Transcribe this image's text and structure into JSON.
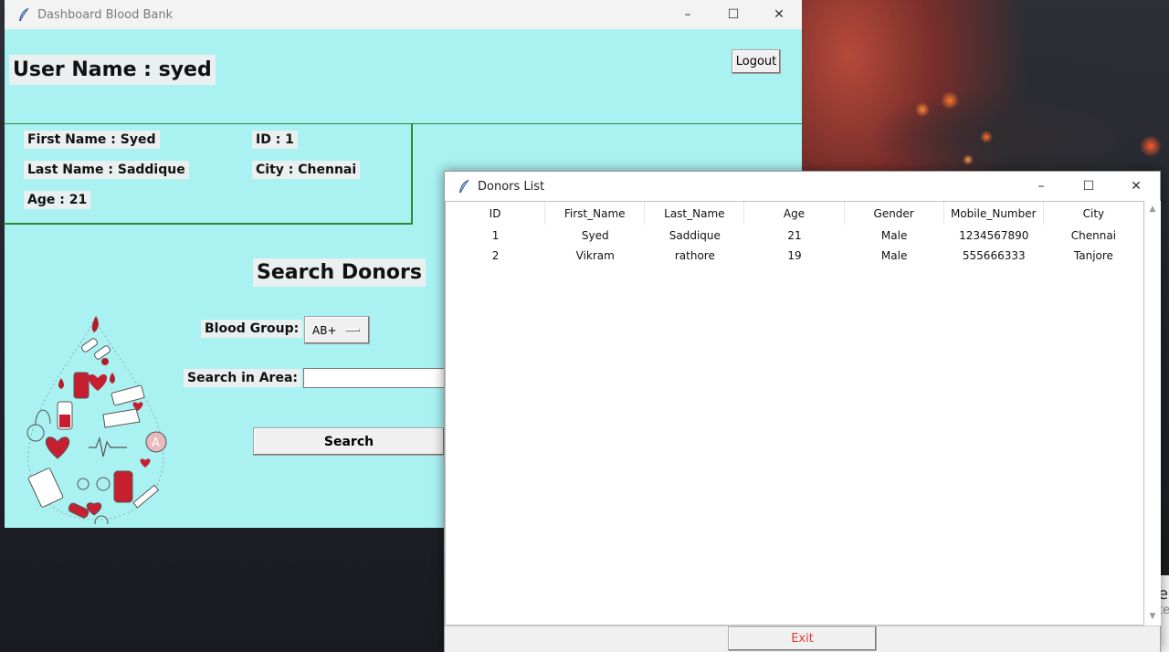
{
  "dashboard": {
    "title": "Dashboard Blood Bank",
    "username_label": "User Name : syed",
    "logout_label": "Logout",
    "first_name": "First Name : Syed",
    "last_name": "Last Name : Saddique",
    "age": "Age : 21",
    "id": "ID : 1",
    "city": "City : Chennai",
    "search_title": "Search Donors",
    "blood_group_label": "Blood Group:",
    "blood_group_value": "AB+",
    "area_label": "Search in Area:",
    "area_value": "",
    "search_button": "Search",
    "background_color": "#aaf1f2"
  },
  "donors_window": {
    "title": "Donors List",
    "columns": [
      "ID",
      "First_Name",
      "Last_Name",
      "Age",
      "Gender",
      "Mobile_Number",
      "City"
    ],
    "rows": [
      [
        "1",
        "Syed",
        "Saddique",
        "21",
        "Male",
        "1234567890",
        "Chennai"
      ],
      [
        "2",
        "Vikram",
        "rathore",
        "19",
        "Male",
        "555666333",
        "Tanjore"
      ]
    ],
    "exit_button": "Exit",
    "exit_color": "#e03a3a"
  },
  "window_controls": {
    "minimize": "–",
    "maximize": "☐",
    "close": "✕"
  },
  "background_edge_text": {
    "line1": "e",
    "line2": "te"
  }
}
